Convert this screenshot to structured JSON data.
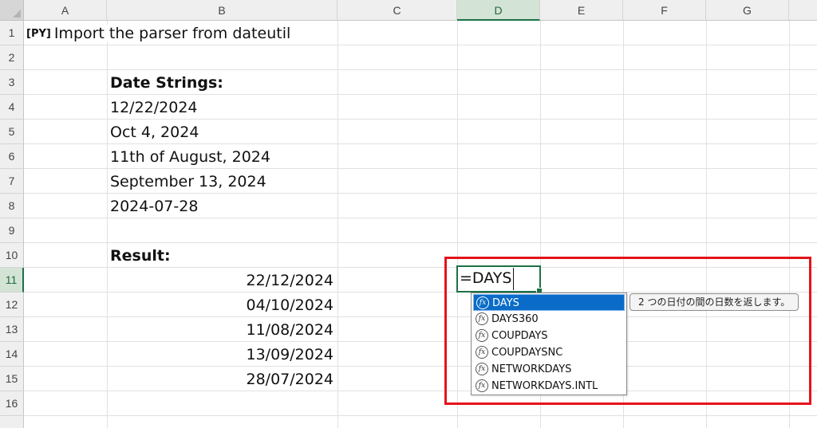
{
  "grid": {
    "columns": [
      "A",
      "B",
      "C",
      "D",
      "E",
      "F",
      "G"
    ],
    "rows": [
      "1",
      "2",
      "3",
      "4",
      "5",
      "6",
      "7",
      "8",
      "9",
      "10",
      "11",
      "12",
      "13",
      "14",
      "15",
      "16"
    ],
    "selected_column": "D",
    "selected_row": "11"
  },
  "cells": {
    "a1_badge": "[PY]",
    "a1": "Import the parser from dateutil",
    "b3": "Date Strings:",
    "b4": "12/22/2024",
    "b5": "Oct 4, 2024",
    "b6": "11th of August, 2024",
    "b7": "September 13, 2024",
    "b8": "2024-07-28",
    "b10": "Result:",
    "b11": "22/12/2024",
    "b12": "04/10/2024",
    "b13": "11/08/2024",
    "b14": "13/09/2024",
    "b15": "28/07/2024"
  },
  "editor": {
    "formula": "=DAYS"
  },
  "autocomplete": {
    "icon": "function-fx-icon",
    "icon_label": "fx",
    "items": [
      "DAYS",
      "DAYS360",
      "COUPDAYS",
      "COUPDAYSNC",
      "NETWORKDAYS",
      "NETWORKDAYS.INTL"
    ],
    "selected_index": 0,
    "tooltip": "2 つの日付の間の日数を返します。"
  },
  "colors": {
    "highlight_box": "#e4141b",
    "active_cell_border": "#1e7145",
    "selection_blue": "#0a6cc8"
  }
}
